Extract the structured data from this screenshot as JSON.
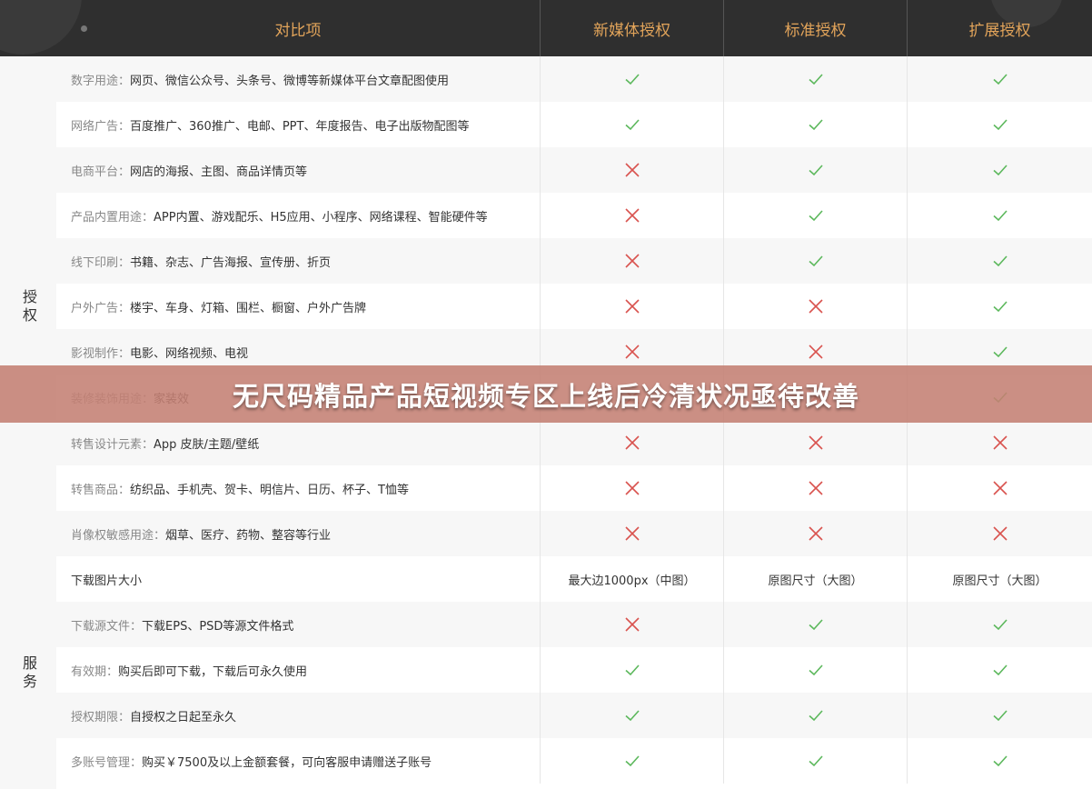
{
  "header": {
    "col_item": "对比项",
    "col_new_media": "新媒体授权",
    "col_standard": "标准授权",
    "col_extended": "扩展授权"
  },
  "groups": {
    "auth": "授权",
    "service": "服务"
  },
  "rows": [
    {
      "label": "数字用途：",
      "text": "网页、微信公众号、头条号、微博等新媒体平台文章配图使用",
      "new_media": "check",
      "standard": "check",
      "extended": "check"
    },
    {
      "label": "网络广告：",
      "text": "百度推广、360推广、电邮、PPT、年度报告、电子出版物配图等",
      "new_media": "check",
      "standard": "check",
      "extended": "check"
    },
    {
      "label": "电商平台：",
      "text": "网店的海报、主图、商品详情页等",
      "new_media": "cross",
      "standard": "check",
      "extended": "check"
    },
    {
      "label": "产品内置用途：",
      "text": "APP内置、游戏配乐、H5应用、小程序、网络课程、智能硬件等",
      "new_media": "cross",
      "standard": "check",
      "extended": "check"
    },
    {
      "label": "线下印刷：",
      "text": "书籍、杂志、广告海报、宣传册、折页",
      "new_media": "cross",
      "standard": "check",
      "extended": "check"
    },
    {
      "label": "户外广告：",
      "text": "楼宇、车身、灯箱、围栏、橱窗、户外广告牌",
      "new_media": "cross",
      "standard": "cross",
      "extended": "check"
    },
    {
      "label": "影视制作：",
      "text": "电影、网络视频、电视",
      "new_media": "cross",
      "standard": "cross",
      "extended": "check"
    },
    {
      "label": "装修装饰用途：",
      "text": "家装效",
      "new_media": "cross",
      "standard": "cross",
      "extended": "check"
    },
    {
      "label": "转售设计元素：",
      "text": "App 皮肤/主题/壁纸",
      "new_media": "cross",
      "standard": "cross",
      "extended": "cross"
    },
    {
      "label": "转售商品：",
      "text": "纺织品、手机壳、贺卡、明信片、日历、杯子、T恤等",
      "new_media": "cross",
      "standard": "cross",
      "extended": "cross"
    },
    {
      "label": "肖像权敏感用途：",
      "text": "烟草、医疗、药物、整容等行业",
      "new_media": "cross",
      "standard": "cross",
      "extended": "cross"
    },
    {
      "label": "",
      "text": "下载图片大小",
      "new_media_text": "最大边1000px（中图）",
      "standard_text": "原图尺寸（大图）",
      "extended_text": "原图尺寸（大图）"
    },
    {
      "label": "下载源文件：",
      "text": "下载EPS、PSD等源文件格式",
      "new_media": "cross",
      "standard": "check",
      "extended": "check"
    },
    {
      "label": "有效期：",
      "text": "购买后即可下载，下载后可永久使用",
      "new_media": "check",
      "standard": "check",
      "extended": "check"
    },
    {
      "label": "授权期限：",
      "text": "自授权之日起至永久",
      "new_media": "check",
      "standard": "check",
      "extended": "check"
    },
    {
      "label": "多账号管理：",
      "text": "购买￥7500及以上金额套餐，可向客服申请赠送子账号",
      "new_media": "check",
      "standard": "check",
      "extended": "check"
    }
  ],
  "banner": {
    "title": "无尺码精品产品短视频专区上线后冷清状况亟待改善"
  },
  "colors": {
    "header_bg": "#2f2f2f",
    "header_text": "#e2a45a",
    "check": "#5cb85c",
    "cross": "#d9534f",
    "banner_bg": "#c48073"
  },
  "icons": {
    "check": "check-icon",
    "cross": "cross-icon"
  }
}
